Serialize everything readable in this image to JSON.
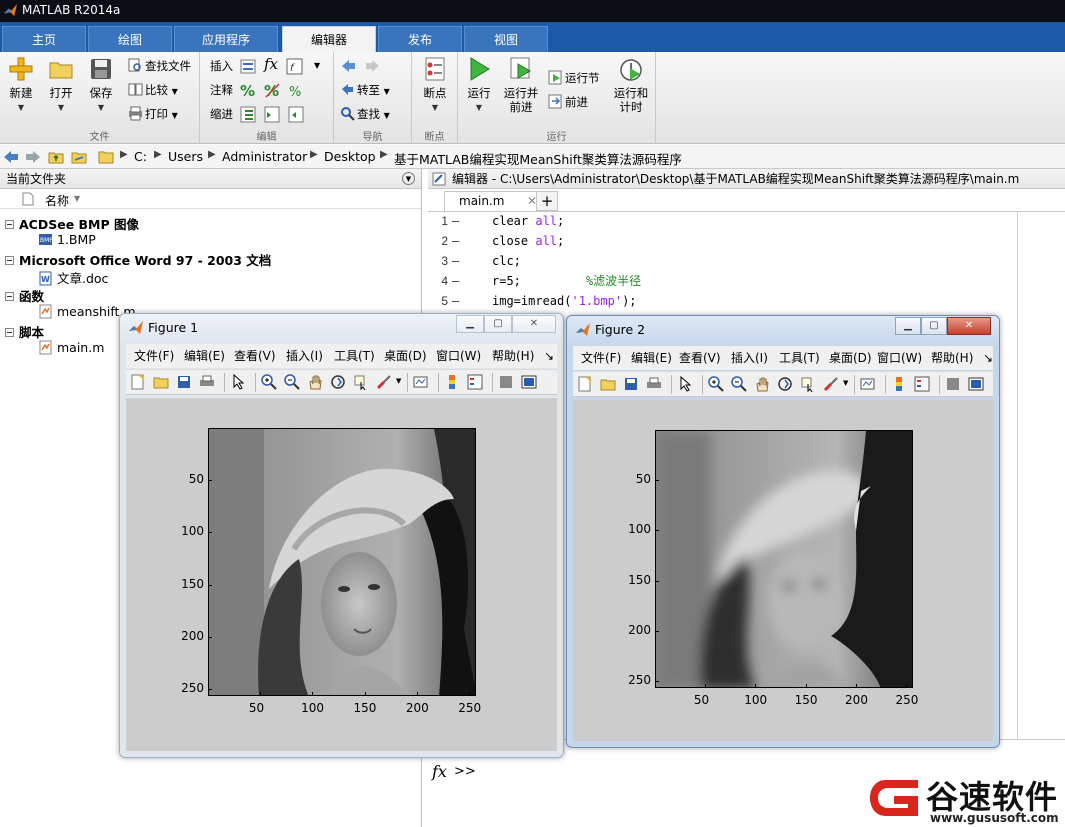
{
  "app": {
    "title": "MATLAB R2014a"
  },
  "tabs": [
    {
      "label": "主页"
    },
    {
      "label": "绘图"
    },
    {
      "label": "应用程序"
    },
    {
      "label": "编辑器"
    },
    {
      "label": "发布"
    },
    {
      "label": "视图"
    }
  ],
  "ribbon": {
    "file": {
      "group_label": "文件",
      "new": "新建",
      "open": "打开",
      "save": "保存",
      "find_files": "查找文件",
      "compare": "比较",
      "print": "打印"
    },
    "edit": {
      "group_label": "编辑",
      "insert": "插入",
      "comment": "注释",
      "indent": "缩进",
      "fx": "fx"
    },
    "navigate": {
      "group_label": "导航",
      "goto": "转至",
      "find": "查找"
    },
    "breakpoints": {
      "group_label": "断点",
      "breakpoints": "断点"
    },
    "run": {
      "group_label": "运行",
      "run": "运行",
      "run_advance_1": "运行并",
      "run_advance_2": "前进",
      "run_section": "运行节",
      "advance": "前进",
      "run_time_1": "运行和",
      "run_time_2": "计时"
    }
  },
  "address": {
    "crumbs": [
      "C:",
      "Users",
      "Administrator",
      "Desktop",
      "基于MATLAB编程实现MeanShift聚类算法源码程序"
    ]
  },
  "folder_panel": {
    "title": "当前文件夹",
    "column_name": "名称",
    "groups": [
      {
        "label": "ACDSee BMP 图像",
        "files": [
          "1.BMP"
        ]
      },
      {
        "label": "Microsoft Office Word 97 - 2003 文档",
        "files": [
          "文章.doc"
        ]
      },
      {
        "label": "函数",
        "files": [
          "meanshift.m"
        ]
      },
      {
        "label": "脚本",
        "files": [
          "main.m"
        ]
      }
    ]
  },
  "editor": {
    "title": "编辑器 - C:\\Users\\Administrator\\Desktop\\基于MATLAB编程实现MeanShift聚类算法源码程序\\main.m",
    "tab_label": "main.m",
    "tab_add": "+",
    "lines": [
      {
        "num": "1",
        "dash": "–",
        "pre": "clear ",
        "str": "all",
        "post": ";",
        "com": ""
      },
      {
        "num": "2",
        "dash": "–",
        "pre": "close ",
        "str": "all",
        "post": ";",
        "com": ""
      },
      {
        "num": "3",
        "dash": "–",
        "pre": "clc;",
        "str": "",
        "post": "",
        "com": ""
      },
      {
        "num": "4",
        "dash": "–",
        "pre": "r=5;         ",
        "str": "",
        "post": "",
        "com": "%滤波半径"
      },
      {
        "num": "5",
        "dash": "–",
        "pre": "img=imread(",
        "str": "'1.bmp'",
        "post": ");",
        "com": ""
      }
    ]
  },
  "command_window": {
    "fx": "fx",
    "prompt": ">>"
  },
  "figures": [
    {
      "title": "Figure 1",
      "menu": [
        "文件(F)",
        "编辑(E)",
        "查看(V)",
        "插入(I)",
        "工具(T)",
        "桌面(D)",
        "窗口(W)",
        "帮助(H)",
        "↘"
      ],
      "x_ticks": [
        "50",
        "100",
        "150",
        "200",
        "250"
      ],
      "y_ticks": [
        "50",
        "100",
        "150",
        "200",
        "250"
      ]
    },
    {
      "title": "Figure 2",
      "menu": [
        "文件(F)",
        "编辑(E)",
        "查看(V)",
        "插入(I)",
        "工具(T)",
        "桌面(D)",
        "窗口(W)",
        "帮助(H)",
        "↘"
      ],
      "x_ticks": [
        "50",
        "100",
        "150",
        "200",
        "250"
      ],
      "y_ticks": [
        "50",
        "100",
        "150",
        "200",
        "250"
      ]
    }
  ],
  "watermark": {
    "text": "谷速软件",
    "url": "www.gususoft.com"
  },
  "colors": {
    "ribbon_blue": "#1b5aa6",
    "titlebar": "#0b0f15",
    "accent_red": "#d9261c"
  }
}
